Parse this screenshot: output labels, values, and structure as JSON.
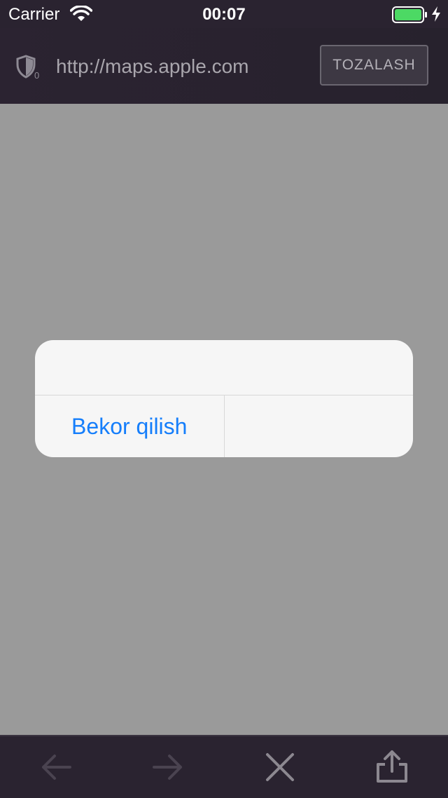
{
  "status": {
    "carrier": "Carrier",
    "time": "00:07",
    "battery_color": "#4cd964"
  },
  "url_bar": {
    "url": "http://maps.apple.com",
    "shield_count": "0",
    "clear_label": "TOZALASH"
  },
  "progress": {
    "value": 0.09,
    "color": "#9c27b0"
  },
  "alert": {
    "title": "",
    "buttons": [
      "Bekor qilish",
      ""
    ]
  },
  "toolbar": {
    "icons": [
      "back-arrow-icon",
      "forward-arrow-icon",
      "close-icon",
      "share-icon"
    ]
  }
}
